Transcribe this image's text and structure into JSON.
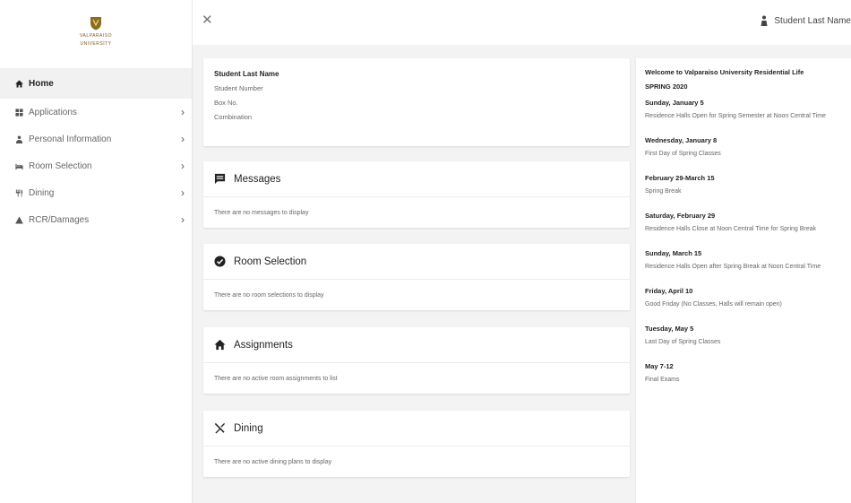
{
  "logo": {
    "name": "VALPARAISO",
    "sub": "UNIVERSITY"
  },
  "sidebar": {
    "items": [
      {
        "label": "Home",
        "icon": "home-icon",
        "active": true
      },
      {
        "label": "Applications",
        "icon": "grid-icon"
      },
      {
        "label": "Personal Information",
        "icon": "person-icon"
      },
      {
        "label": "Room Selection",
        "icon": "bed-icon"
      },
      {
        "label": "Dining",
        "icon": "dining-icon"
      },
      {
        "label": "RCR/Damages",
        "icon": "warning-icon"
      }
    ],
    "chevron": "›"
  },
  "topbar": {
    "close_label": "✕",
    "user_name": "Student Last Name"
  },
  "profile": {
    "name": "Student Last Name",
    "student_number": "Student Number",
    "box_no": "Box No.",
    "combination": "Combination"
  },
  "sections": {
    "messages": {
      "title": "Messages",
      "empty": "There are no messages to display"
    },
    "room_selection": {
      "title": "Room Selection",
      "empty": "There are no room selections to display"
    },
    "assignments": {
      "title": "Assignments",
      "empty": "There are no active room assignments to list"
    },
    "dining": {
      "title": "Dining",
      "empty": "There are no active dining plans to display"
    }
  },
  "news": {
    "heading": "Welcome to Valparaiso University Residential Life",
    "semester": "SPRING 2020",
    "events": [
      {
        "date": "Sunday, January 5",
        "desc": "Residence Halls Open for Spring Semester at Noon Central Time"
      },
      {
        "date": "Wednesday, January 8",
        "desc": "First Day of Spring Classes"
      },
      {
        "date": "February 29-March 15",
        "desc": "Spring Break"
      },
      {
        "date": "Saturday, February 29",
        "desc": "Residence Halls Close at Noon Central Time for Spring Break"
      },
      {
        "date": "Sunday, March 15",
        "desc": "Residence Halls Open after Spring Break at Noon Central Time"
      },
      {
        "date": "Friday, April 10",
        "desc": "Good Friday (No Classes, Halls will remain open)"
      },
      {
        "date": "Tuesday, May 5",
        "desc": "Last Day of Spring Classes"
      },
      {
        "date": "May 7-12",
        "desc": "Final Exams"
      }
    ]
  },
  "colors": {
    "background": "#f3f3f3",
    "card": "#ffffff",
    "brand_gold": "#7a5b14",
    "text_dark": "#222222",
    "text_muted": "#666666"
  }
}
